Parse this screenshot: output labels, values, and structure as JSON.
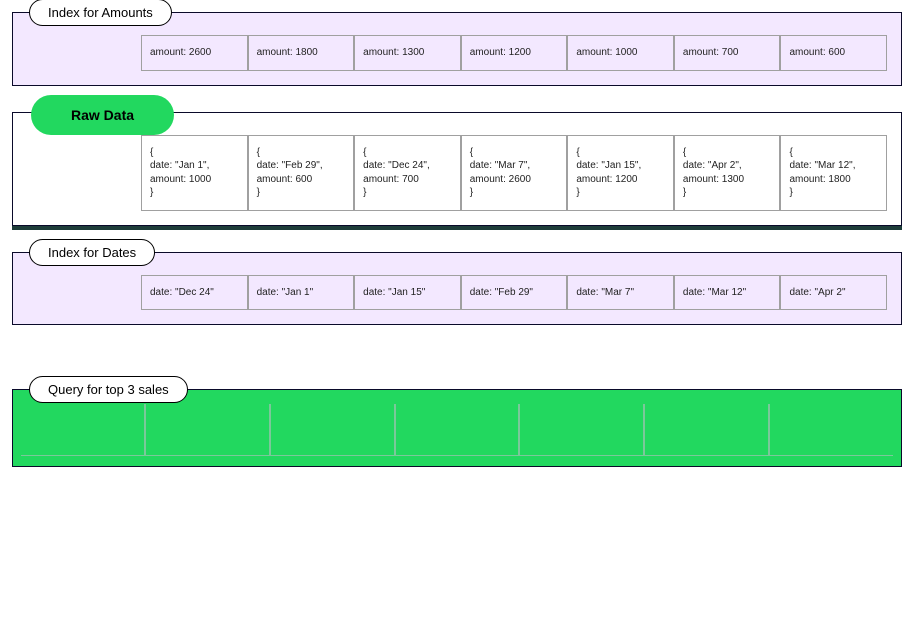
{
  "amounts_panel": {
    "title": "Index for Amounts",
    "cells": [
      "amount: 2600",
      "amount: 1800",
      "amount: 1300",
      "amount: 1200",
      "amount: 1000",
      "amount: 700",
      "amount: 600"
    ]
  },
  "raw_panel": {
    "title": "Raw Data",
    "cells": [
      "{\n  date: \"Jan 1\",\n  amount: 1000\n}",
      "{\n  date: \"Feb 29\",\n  amount: 600\n}",
      "{\n  date: \"Dec 24\",\n  amount: 700\n}",
      "{\n  date: \"Mar 7\",\n  amount: 2600\n}",
      "{\n  date: \"Jan 15\",\n  amount: 1200\n}",
      "{\n  date: \"Apr 2\",\n  amount: 1300\n}",
      "{\n  date: \"Mar 12\",\n  amount: 1800\n}"
    ]
  },
  "dates_panel": {
    "title": "Index for Dates",
    "cells": [
      "date: \"Dec 24\"",
      "date: \"Jan 1\"",
      "date: \"Jan 15\"",
      "date: \"Feb 29\"",
      "date: \"Mar 7\"",
      "date: \"Mar 12\"",
      "date: \"Apr 2\""
    ]
  },
  "query_panel": {
    "title": "Query for top 3 sales"
  }
}
